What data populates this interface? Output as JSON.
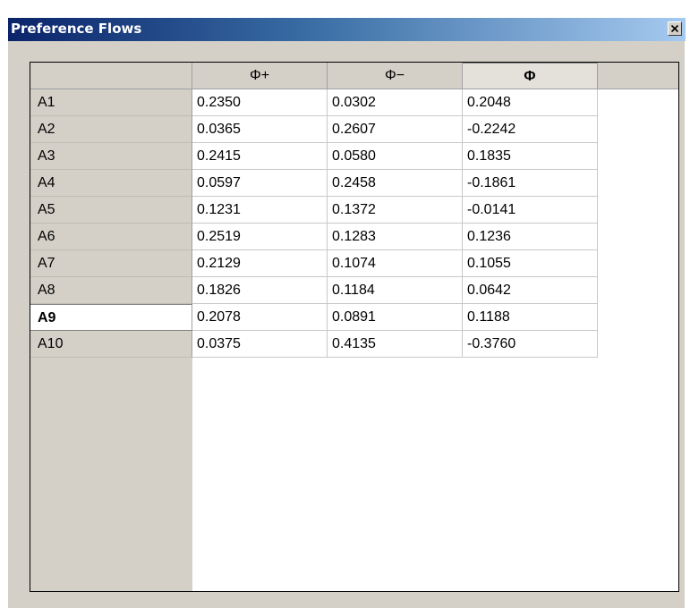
{
  "window": {
    "title": "Preference Flows",
    "close_label": "×"
  },
  "table": {
    "columns": [
      "Φ+",
      "Φ−",
      "Φ"
    ],
    "active_column": 2,
    "selected_row": 8,
    "rows": [
      {
        "label": "A1",
        "values": [
          "0.2350",
          "0.0302",
          "0.2048"
        ]
      },
      {
        "label": "A2",
        "values": [
          "0.0365",
          "0.2607",
          "-0.2242"
        ]
      },
      {
        "label": "A3",
        "values": [
          "0.2415",
          "0.0580",
          "0.1835"
        ]
      },
      {
        "label": "A4",
        "values": [
          "0.0597",
          "0.2458",
          "-0.1861"
        ]
      },
      {
        "label": "A5",
        "values": [
          "0.1231",
          "0.1372",
          "-0.0141"
        ]
      },
      {
        "label": "A6",
        "values": [
          "0.2519",
          "0.1283",
          "0.1236"
        ]
      },
      {
        "label": "A7",
        "values": [
          "0.2129",
          "0.1074",
          "0.1055"
        ]
      },
      {
        "label": "A8",
        "values": [
          "0.1826",
          "0.1184",
          "0.0642"
        ]
      },
      {
        "label": "A9",
        "values": [
          "0.2078",
          "0.0891",
          "0.1188"
        ]
      },
      {
        "label": "A10",
        "values": [
          "0.0375",
          "0.4135",
          "-0.3760"
        ]
      }
    ]
  }
}
